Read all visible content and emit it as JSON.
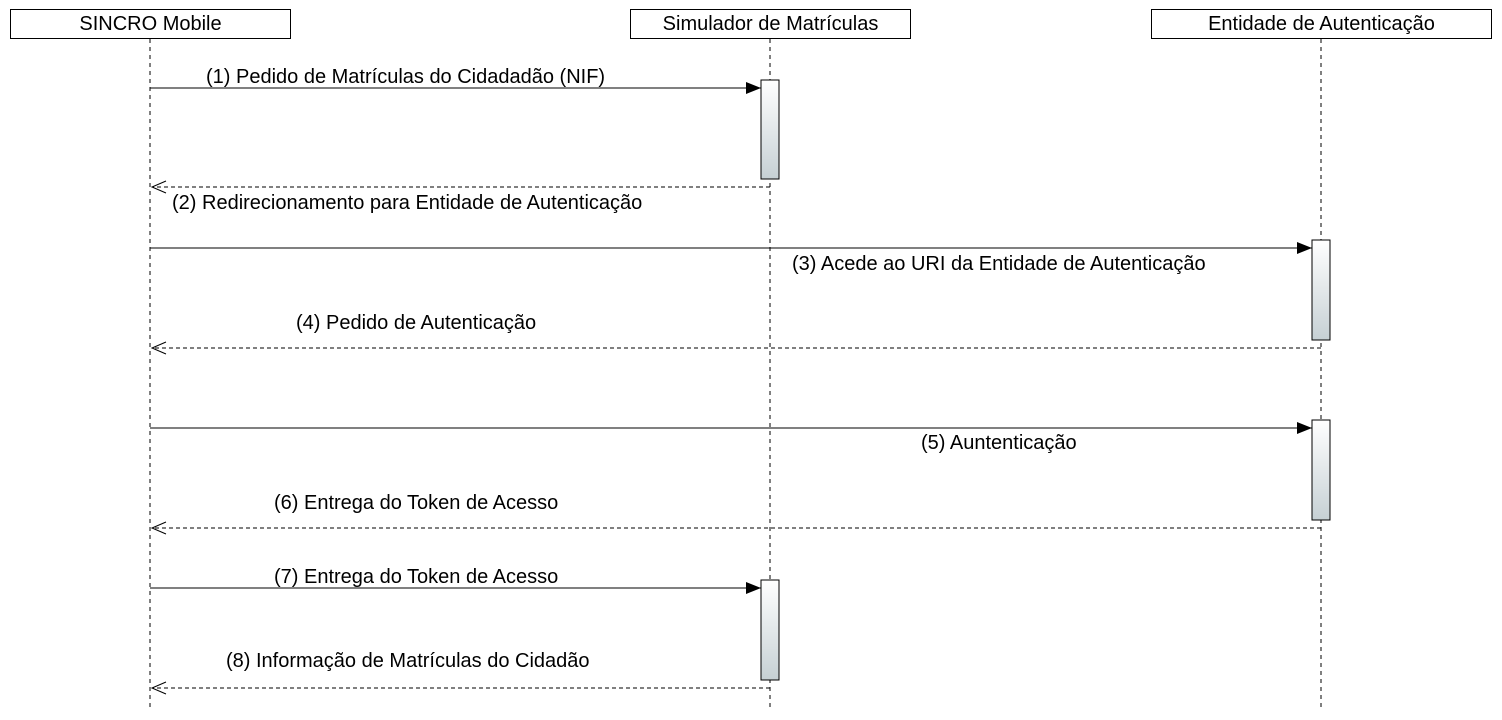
{
  "participants": [
    {
      "id": "sincro",
      "label": "SINCRO Mobile"
    },
    {
      "id": "simulador",
      "label": "Simulador de Matrículas"
    },
    {
      "id": "entidade",
      "label": "Entidade de Autenticação"
    }
  ],
  "messages": [
    {
      "from": "sincro",
      "to": "simulador",
      "kind": "sync",
      "label": "(1) Pedido de Matrículas do Cidadadão (NIF)"
    },
    {
      "from": "simulador",
      "to": "sincro",
      "kind": "return",
      "label": "(2) Redirecionamento para Entidade de Autenticação"
    },
    {
      "from": "sincro",
      "to": "entidade",
      "kind": "sync",
      "label": "(3) Acede ao URI da Entidade de Autenticação"
    },
    {
      "from": "entidade",
      "to": "sincro",
      "kind": "return",
      "label": "(4) Pedido de Autenticação"
    },
    {
      "from": "sincro",
      "to": "entidade",
      "kind": "sync",
      "label": "(5) Auntenticação"
    },
    {
      "from": "entidade",
      "to": "sincro",
      "kind": "return",
      "label": "(6) Entrega do Token de Acesso"
    },
    {
      "from": "sincro",
      "to": "simulador",
      "kind": "sync",
      "label": "(7) Entrega do Token de Acesso"
    },
    {
      "from": "simulador",
      "to": "sincro",
      "kind": "return",
      "label": "(8) Informação de Matrículas do Cidadão"
    }
  ],
  "activations": [
    {
      "participant": "simulador",
      "from_message": 1,
      "to_message": 2
    },
    {
      "participant": "entidade",
      "from_message": 3,
      "to_message": 4
    },
    {
      "participant": "entidade",
      "from_message": 5,
      "to_message": 6
    },
    {
      "participant": "simulador",
      "from_message": 7,
      "to_message": 8
    }
  ]
}
